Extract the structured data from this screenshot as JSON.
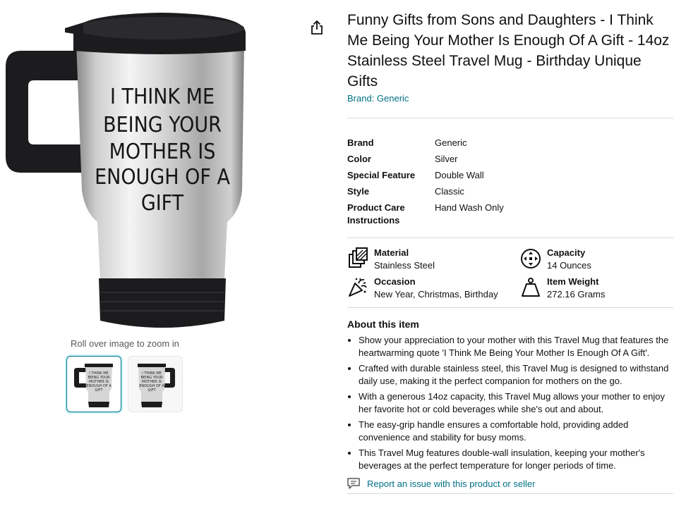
{
  "product": {
    "title": "Funny Gifts from Sons and Daughters - I Think Me Being Your Mother Is Enough Of A Gift - 14oz Stainless Steel Travel Mug - Birthday Unique Gifts",
    "brand_link": "Brand: Generic",
    "mug_print_lines": [
      "I THINK ME",
      "BEING YOUR",
      "MOTHER IS",
      "ENOUGH OF A",
      "GIFT"
    ]
  },
  "gallery": {
    "zoom_hint": "Roll over image to zoom in"
  },
  "specs": [
    {
      "key": "Brand",
      "value": "Generic"
    },
    {
      "key": "Color",
      "value": "Silver"
    },
    {
      "key": "Special Feature",
      "value": "Double Wall"
    },
    {
      "key": "Style",
      "value": "Classic"
    },
    {
      "key": "Product Care Instructions",
      "value": "Hand Wash Only"
    }
  ],
  "features": [
    {
      "label": "Material",
      "value": "Stainless Steel",
      "icon": "material-icon"
    },
    {
      "label": "Capacity",
      "value": "14 Ounces",
      "icon": "capacity-icon"
    },
    {
      "label": "Occasion",
      "value": "New Year, Christmas, Birthday",
      "icon": "party-popper-icon"
    },
    {
      "label": "Item Weight",
      "value": "272.16 Grams",
      "icon": "weight-icon"
    }
  ],
  "about": {
    "heading": "About this item",
    "bullets": [
      "Show your appreciation to your mother with this Travel Mug that features the heartwarming quote 'I Think Me Being Your Mother Is Enough Of A Gift'.",
      "Crafted with durable stainless steel, this Travel Mug is designed to withstand daily use, making it the perfect companion for mothers on the go.",
      "With a generous 14oz capacity, this Travel Mug allows your mother to enjoy her favorite hot or cold beverages while she's out and about.",
      "The easy-grip handle ensures a comfortable hold, providing added convenience and stability for busy moms.",
      "This Travel Mug features double-wall insulation, keeping your mother's beverages at the perfect temperature for longer periods of time."
    ]
  },
  "report_link": "Report an issue with this product or seller",
  "colors": {
    "link": "#007185",
    "divider": "#d5d9d9",
    "text": "#0f1111"
  }
}
